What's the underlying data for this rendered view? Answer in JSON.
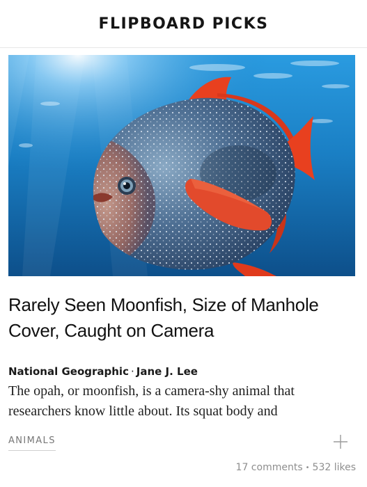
{
  "header": {
    "title": "FLIPBOARD PICKS"
  },
  "article": {
    "image_subject": "opah-moonfish-underwater-photo",
    "headline": "Rarely Seen Moonfish, Size of Manhole Cover, Caught on Camera",
    "source": "National Geographic",
    "byline_separator": "·",
    "author": "Jane J. Lee",
    "excerpt": "The opah, or moonfish, is a camera-shy animal that researchers know little about. Its squat body and",
    "topic": "ANIMALS",
    "comments": "17 comments",
    "stats_separator": "•",
    "likes": "532 likes"
  },
  "icons": {
    "add": "plus-icon"
  },
  "colors": {
    "text": "#111111",
    "muted": "#8e8e8e",
    "water": "#1a7fc4",
    "fish_fin": "#e8401f"
  }
}
